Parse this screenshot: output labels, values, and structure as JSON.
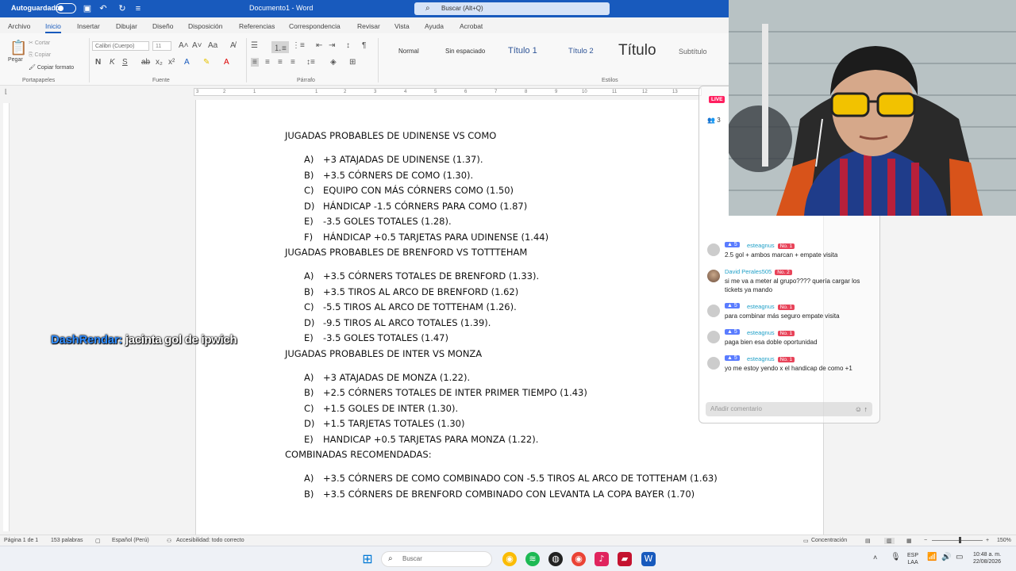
{
  "titlebar": {
    "autosave_label": "Autoguardado",
    "doc_title": "Documento1 - Word",
    "search_placeholder": "Buscar (Alt+Q)"
  },
  "ribbon_tabs": [
    "Archivo",
    "Inicio",
    "Insertar",
    "Dibujar",
    "Diseño",
    "Disposición",
    "Referencias",
    "Correspondencia",
    "Revisar",
    "Vista",
    "Ayuda",
    "Acrobat"
  ],
  "ribbon": {
    "paste_label": "Pegar",
    "cut_label": "Cortar",
    "copy_label": "Copiar",
    "format_painter_label": "Copiar formato",
    "clipboard_group": "Portapapeles",
    "font_name": "Calibri (Cuerpo)",
    "font_size": "11",
    "font_group": "Fuente",
    "paragraph_group": "Párrafo",
    "styles_group": "Estilos",
    "styles": [
      "Normal",
      "Sin espaciado",
      "Título 1",
      "Título 2",
      "Título",
      "Subtítulo"
    ]
  },
  "ruler_ticks": [
    "3",
    "2",
    "1",
    "1",
    "2",
    "3",
    "4",
    "5",
    "6",
    "7",
    "8",
    "9",
    "10",
    "11",
    "12",
    "13"
  ],
  "document": {
    "sections": [
      {
        "title": "JUGADAS PROBABLES DE UDINENSE VS COMO",
        "items": [
          {
            "letter": "A)",
            "text": "+3 ATAJADAS DE UDINENSE (1.37)."
          },
          {
            "letter": "B)",
            "text": "+3.5 CÓRNERS DE COMO (1.30)."
          },
          {
            "letter": "C)",
            "text": "EQUIPO CON MÁS CÓRNERS COMO (1.50)"
          },
          {
            "letter": "D)",
            "text": "HÁNDICAP -1.5 CÓRNERS PARA COMO (1.87)"
          },
          {
            "letter": "E)",
            "text": "-3.5 GOLES TOTALES (1.28)."
          },
          {
            "letter": "F)",
            "text": "HÁNDICAP +0.5 TARJETAS PARA UDINENSE (1.44)"
          }
        ]
      },
      {
        "title": "JUGADAS PROBABLES DE BRENFORD VS TOTTTEHAM",
        "items": [
          {
            "letter": "A)",
            "text": "+3.5 CÓRNERS TOTALES DE BRENFORD (1.33)."
          },
          {
            "letter": "B)",
            "text": "+3.5 TIROS AL ARCO DE BRENFORD (1.62)"
          },
          {
            "letter": "C)",
            "text": "-5.5 TIROS AL ARCO DE TOTTEHAM (1.26)."
          },
          {
            "letter": "D)",
            "text": "-9.5 TIROS AL ARCO TOTALES (1.39)."
          },
          {
            "letter": "E)",
            "text": "-3.5 GOLES TOTALES (1.47)"
          }
        ]
      },
      {
        "title": "JUGADAS PROBABLES DE INTER VS MONZA",
        "items": [
          {
            "letter": "A)",
            "text": "+3 ATAJADAS DE MONZA (1.22)."
          },
          {
            "letter": "B)",
            "text": "+2.5 CÓRNERS TOTALES DE INTER PRIMER TIEMPO (1.43)"
          },
          {
            "letter": "C)",
            "text": "+1.5 GOLES DE INTER (1.30)."
          },
          {
            "letter": "D)",
            "text": "+1.5 TARJETAS TOTALES (1.30)"
          },
          {
            "letter": "E)",
            "text": "HANDICAP +0.5 TARJETAS PARA MONZA (1.22)."
          }
        ]
      },
      {
        "title": "COMBINADAS RECOMENDADAS:",
        "items": [
          {
            "letter": "A)",
            "text": "+3.5 CÓRNERS DE COMO COMBINADO CON -5.5 TIROS AL ARCO DE TOTTEHAM (1.63)"
          },
          {
            "letter": "B)",
            "text": "+3.5 CÓRNERS DE BRENFORD COMBINADO CON LEVANTA LA COPA BAYER (1.70)"
          }
        ]
      }
    ]
  },
  "overlay_caption": {
    "user": "DashRendar:",
    "message": "jacinta gol de ipwich"
  },
  "live": {
    "badge": "LIVE",
    "viewers": "3",
    "chat": [
      {
        "type": "fan",
        "level": "5",
        "name": "esteagnus",
        "rank": "No. 1",
        "message": "2.5 gol + ambos marcan + empate visita"
      },
      {
        "type": "named",
        "name": "David Perales505",
        "rank": "No. 2",
        "message": "si me va a meter al grupo???? quería cargar los tickets ya mando"
      },
      {
        "type": "fan",
        "level": "5",
        "name": "esteagnus",
        "rank": "No. 1",
        "message": "para combinar más seguro empate visita"
      },
      {
        "type": "fan",
        "level": "5",
        "name": "esteagnus",
        "rank": "No. 1",
        "message": "paga bien esa doble oportunidad"
      },
      {
        "type": "fan",
        "level": "5",
        "name": "esteagnus",
        "rank": "No. 1",
        "message": "yo me estoy yendo x el handicap de como +1"
      }
    ],
    "comment_placeholder": "Añadir comentario"
  },
  "statusbar": {
    "page": "Página 1 de 1",
    "words": "153 palabras",
    "language": "Español (Perú)",
    "accessibility": "Accesibilidad: todo correcto",
    "focus": "Concentración",
    "zoom": "150%"
  },
  "taskbar": {
    "search_placeholder": "Buscar",
    "lang_line1": "ESP",
    "lang_line2": "LAA",
    "time": "10:48 a. m.",
    "date": "22/08/2026"
  },
  "colors": {
    "word_blue": "#185abd",
    "live_red": "#ff2060",
    "caption_user": "#2f8cff"
  }
}
